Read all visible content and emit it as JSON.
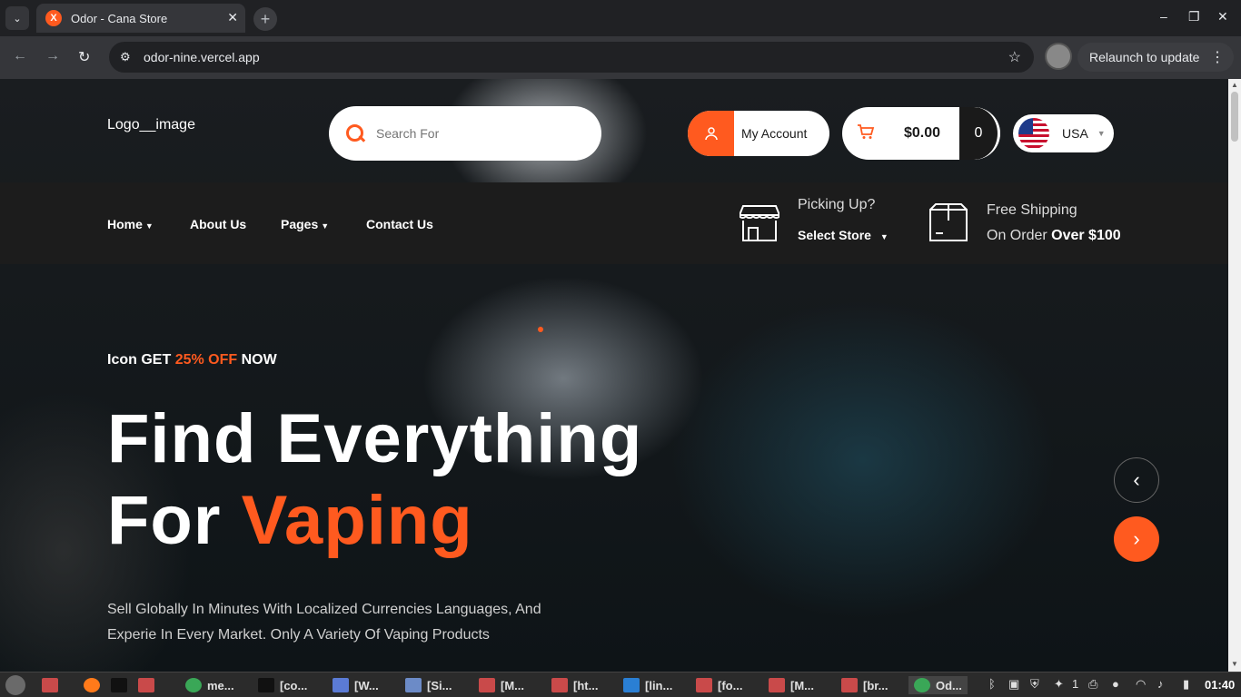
{
  "browser": {
    "tab_title": "Odor - Cana Store",
    "favicon_letter": "X",
    "url": "odor-nine.vercel.app",
    "relaunch_label": "Relaunch to update",
    "tab_close": "✕",
    "new_tab": "+",
    "minimize": "–",
    "maximize": "❐",
    "close": "✕",
    "menu": "⌄",
    "back": "←",
    "forward": "→",
    "reload": "↻",
    "star": "☆",
    "kebab": "⋮",
    "site_info": "⚙"
  },
  "header": {
    "logo_alt": "Logo__image",
    "search_placeholder": "Search For",
    "account_label": "My Account",
    "cart_total": "$0.00",
    "cart_count": "0",
    "country": "USA"
  },
  "nav": {
    "items": [
      {
        "label": "Home",
        "has_dropdown": true
      },
      {
        "label": "About Us",
        "has_dropdown": false
      },
      {
        "label": "Pages",
        "has_dropdown": true
      },
      {
        "label": "Contact Us",
        "has_dropdown": false
      }
    ],
    "pickup_title": "Picking Up?",
    "pickup_select": "Select Store",
    "shipping_title": "Free Shipping",
    "shipping_prefix": "On Order",
    "shipping_bold": "Over $100"
  },
  "hero": {
    "promo_icon_alt": "Icon",
    "promo_get": "GET",
    "promo_off": "25% OFF",
    "promo_now": "NOW",
    "headline_line1": "Find Everything",
    "headline_for": "For",
    "headline_accent": "Vaping",
    "description": "Sell Globally In Minutes With Localized Currencies Languages, And Experie In Every Market. Only A Variety Of Vaping Products"
  },
  "taskbar": {
    "items": [
      "me...",
      "[co...",
      "[W...",
      "[Si...",
      "[M...",
      "[ht...",
      "[lin...",
      "[fo...",
      "[M...",
      "[br...",
      "Od..."
    ],
    "tray_count": "1",
    "clock": "01:40"
  },
  "colors": {
    "accent": "#ff5a1f",
    "nav_bg": "#1c1c1c",
    "chrome_bg": "#202124"
  }
}
